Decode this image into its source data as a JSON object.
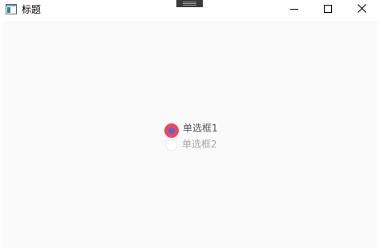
{
  "window": {
    "title": "标题",
    "icon": "app-window-icon",
    "controls": {
      "minimize_icon": "minimize-icon",
      "maximize_icon": "maximize-icon",
      "close_icon": "close-icon"
    }
  },
  "radio_group": {
    "options": [
      {
        "label": "单选框1",
        "checked": true
      },
      {
        "label": "单选框2",
        "checked": false
      }
    ]
  },
  "colors": {
    "radio_checked_ring": "#e84a5f",
    "radio_checked_dot": "#6a5fd0",
    "radio_label_active": "#555555",
    "radio_label_inactive": "#a8a8a8",
    "content_background": "#fafafa"
  }
}
